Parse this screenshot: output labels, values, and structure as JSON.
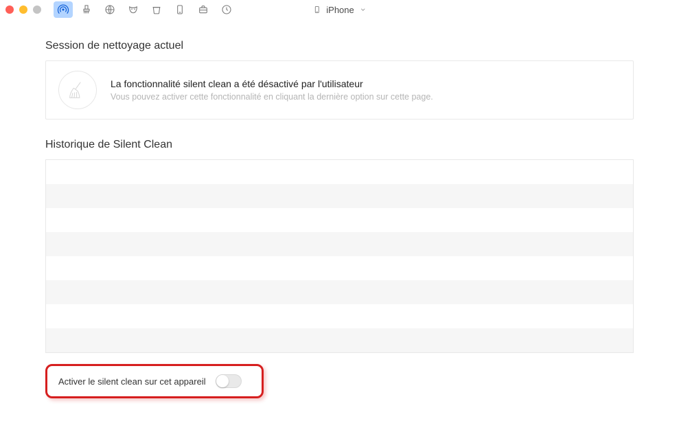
{
  "device": {
    "label": "iPhone"
  },
  "session": {
    "heading": "Session de nettoyage actuel",
    "title": "La fonctionnalité silent clean a été désactivé par l'utilisateur",
    "subtitle": "Vous pouvez activer cette fonctionnalité en cliquant la dernière option sur cette page."
  },
  "history": {
    "heading": "Historique de Silent Clean",
    "rows": [
      "",
      "",
      "",
      "",
      "",
      "",
      "",
      ""
    ]
  },
  "activate": {
    "label": "Activer le silent clean sur cet appareil",
    "enabled": false
  }
}
